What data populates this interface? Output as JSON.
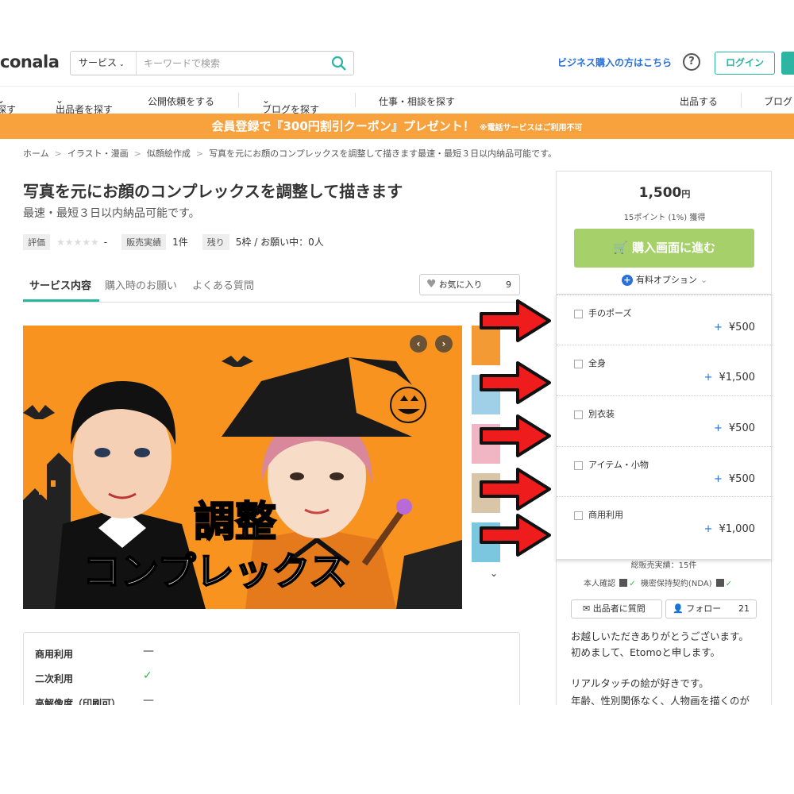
{
  "header": {
    "logo": "conala",
    "search_category": "サービス",
    "search_placeholder": "キーワードで検索",
    "biz_link": "ビジネス購入の方はこちら",
    "help": "?",
    "login": "ログイン"
  },
  "nav": {
    "items": [
      "探す",
      "出品者を探す",
      "公開依頼をする",
      "ブログを探す",
      "仕事・相談を探す",
      "出品する",
      "ブログ"
    ]
  },
  "banner": {
    "main": "会員登録で『300円割引クーポン』プレゼント！",
    "note": "※電話サービスはご利用不可"
  },
  "breadcrumb": [
    "ホーム",
    "イラスト・漫画",
    "似顔絵作成",
    "写真を元にお顔のコンプレックスを調整して描きます最速・最短３日以内納品可能です。"
  ],
  "service": {
    "title": "写真を元にお顔のコンプレックスを調整して描きます",
    "subtitle": "最速・最短３日以内納品可能です。",
    "rating_label": "評価",
    "rating_stars": "★★★★★",
    "rating_value": "-",
    "sales_label": "販売実績",
    "sales_value": "1件",
    "remaining_label": "残り",
    "remaining_value": "5枠 / お願い中：0人"
  },
  "tabs": [
    "サービス内容",
    "購入時のお願い",
    "よくある質問"
  ],
  "favorite": {
    "label": "お気に入り",
    "count": "9"
  },
  "hero": {
    "caption1": "調整",
    "caption2": "コンプレックス",
    "prev": "‹",
    "next": "›"
  },
  "spec": [
    {
      "label": "商用利用",
      "value": "—"
    },
    {
      "label": "二次利用",
      "value": "✓"
    },
    {
      "label": "高解像度（印刷可）",
      "value": "—"
    }
  ],
  "panel": {
    "price": "1,500",
    "price_unit": "円",
    "points": "15ポイント (1%) 獲得",
    "buy": "購入画面に進む",
    "options_toggle": "有料オプション"
  },
  "options": [
    {
      "name": "手のポーズ",
      "price": "¥500"
    },
    {
      "name": "全身",
      "price": "¥1,500"
    },
    {
      "name": "別衣装",
      "price": "¥500"
    },
    {
      "name": "アイテム・小物",
      "price": "¥500"
    },
    {
      "name": "商用利用",
      "price": "¥1,000"
    }
  ],
  "seller": {
    "total_sales": "総販売実績：15件",
    "identity": "本人確認",
    "nda": "機密保持契約(NDA)",
    "ask": "出品者に質問",
    "follow": "フォロー",
    "follow_count": "21",
    "bio": [
      "お越しいただきありがとうございます。",
      "初めまして、Etomoと申します。",
      "",
      "リアルタッチの絵が好きです。",
      "年齢、性別関係なく、人物画を描くのが"
    ]
  },
  "colors": {
    "accent": "#2bb5a2",
    "banner": "#f8a23d",
    "buy": "#a6d16a",
    "link": "#2a6fdb"
  }
}
